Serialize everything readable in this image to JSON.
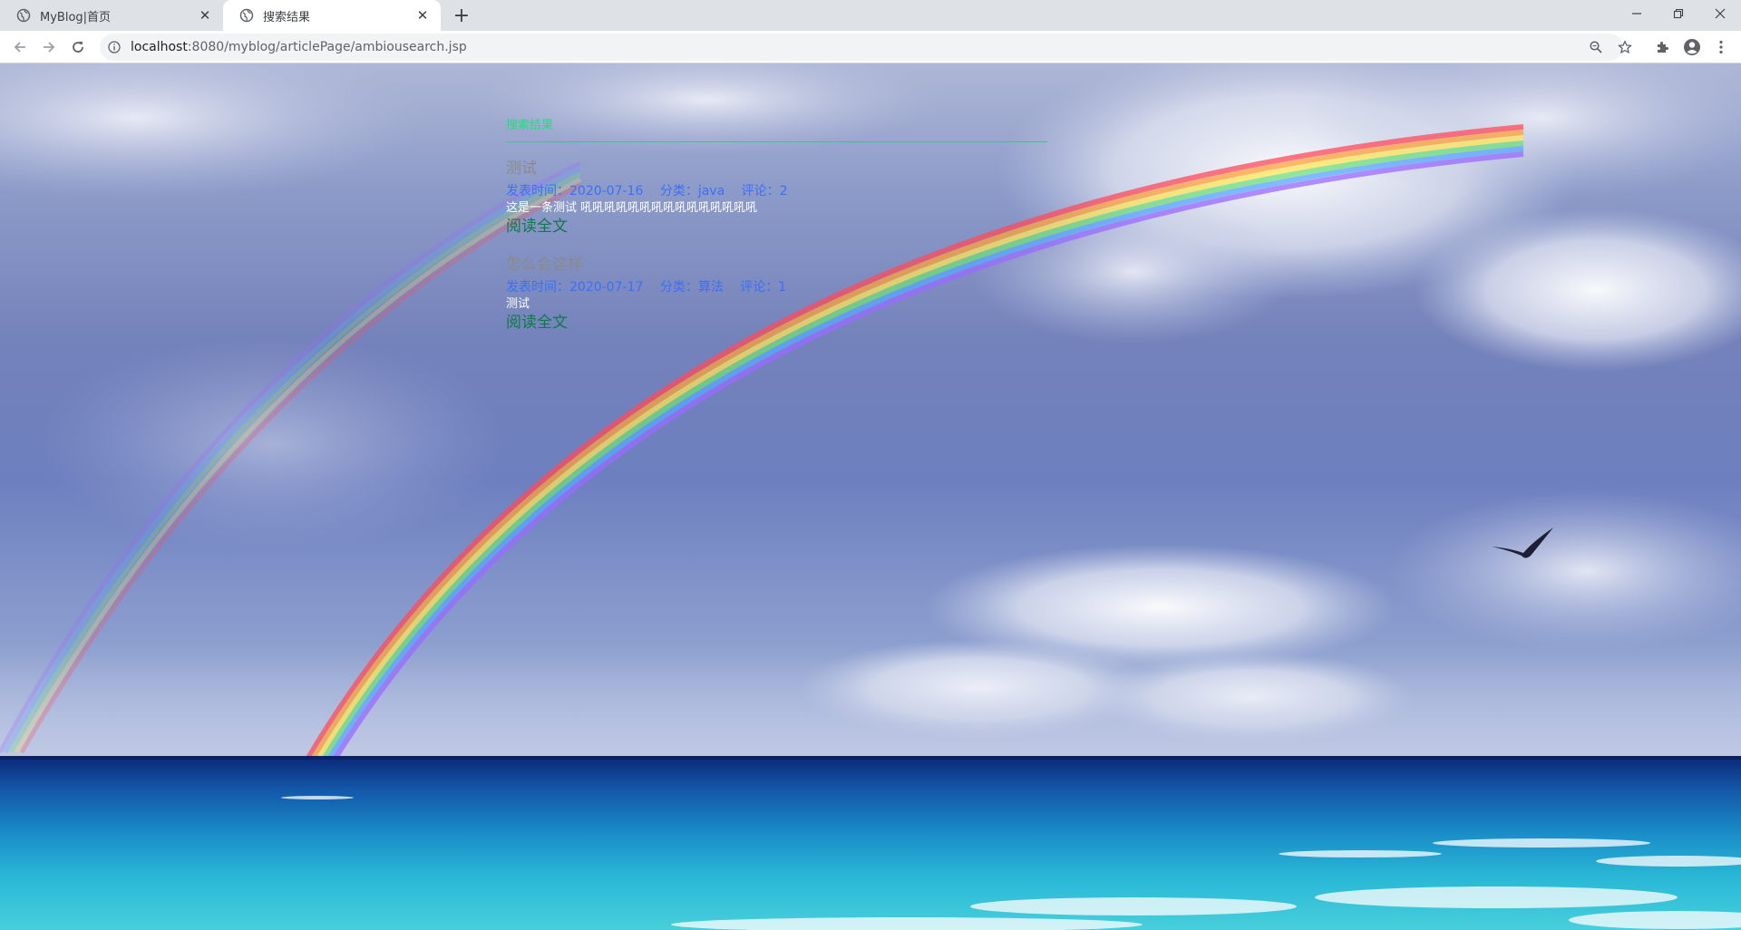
{
  "browser": {
    "tabs": [
      {
        "title": "MyBlog|首页",
        "active": false
      },
      {
        "title": "搜索结果",
        "active": true
      }
    ],
    "url": {
      "host": "localhost",
      "path": ":8080/myblog/articlePage/ambiousearch.jsp"
    },
    "icons": {
      "back": "arrow-left-icon",
      "forward": "arrow-right-icon",
      "reload": "reload-icon",
      "site_info": "info-icon",
      "zoom": "zoom-icon",
      "bookmark": "star-icon",
      "extensions": "puzzle-icon",
      "profile": "account-icon",
      "menu": "kebab-menu-icon"
    }
  },
  "page": {
    "section_title": "搜索结果",
    "read_more_label": "阅读全文",
    "articles": [
      {
        "title": "测试",
        "date_label": "发表时间：2020-07-16",
        "category_label": "分类：java",
        "comments_label": "评论：2",
        "summary": "这是一条测试 吼吼吼吼吼吼吼吼吼吼吼吼吼吼吼"
      },
      {
        "title": "怎么会这样",
        "date_label": "发表时间：2020-07-17",
        "category_label": "分类：算法",
        "comments_label": "评论：1",
        "summary": "测试"
      }
    ]
  },
  "colors": {
    "section_title": "#19e27a",
    "article_title": "#8a8a8a",
    "meta": "#3b6ff5",
    "read_more": "#0d7a48"
  }
}
